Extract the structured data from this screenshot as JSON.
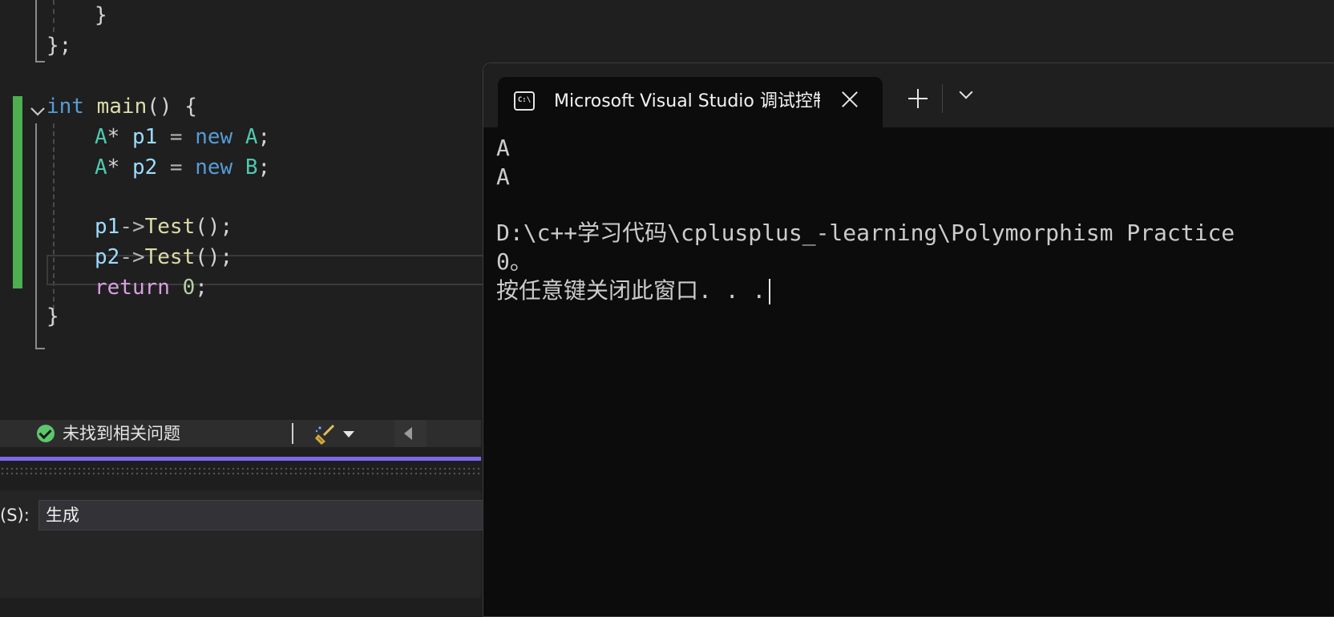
{
  "editor": {
    "lines": [
      {
        "indent": 4,
        "tokens": [
          {
            "t": "}",
            "c": "pu"
          }
        ]
      },
      {
        "indent": 0,
        "tokens": [
          {
            "t": "};",
            "c": "pu"
          }
        ]
      },
      {
        "indent": 0,
        "tokens": [
          {
            "t": "int",
            "c": "kw"
          },
          {
            "t": " ",
            "c": "pu"
          },
          {
            "t": "main",
            "c": "fn"
          },
          {
            "t": "() {",
            "c": "pu"
          }
        ]
      },
      {
        "indent": 4,
        "tokens": [
          {
            "t": "A",
            "c": "ty"
          },
          {
            "t": "* ",
            "c": "pu"
          },
          {
            "t": "p1",
            "c": "id"
          },
          {
            "t": " = ",
            "c": "op"
          },
          {
            "t": "new",
            "c": "kw"
          },
          {
            "t": " ",
            "c": "pu"
          },
          {
            "t": "A",
            "c": "ty"
          },
          {
            "t": ";",
            "c": "pu"
          }
        ]
      },
      {
        "indent": 4,
        "tokens": [
          {
            "t": "A",
            "c": "ty"
          },
          {
            "t": "* ",
            "c": "pu"
          },
          {
            "t": "p2",
            "c": "id"
          },
          {
            "t": " = ",
            "c": "op"
          },
          {
            "t": "new",
            "c": "kw"
          },
          {
            "t": " ",
            "c": "pu"
          },
          {
            "t": "B",
            "c": "ty"
          },
          {
            "t": ";",
            "c": "pu"
          }
        ]
      },
      {
        "indent": 4,
        "tokens": [
          {
            "t": "p1",
            "c": "id"
          },
          {
            "t": "->",
            "c": "op"
          },
          {
            "t": "Test",
            "c": "fn"
          },
          {
            "t": "();",
            "c": "pu"
          }
        ]
      },
      {
        "indent": 4,
        "tokens": [
          {
            "t": "p2",
            "c": "id"
          },
          {
            "t": "->",
            "c": "op"
          },
          {
            "t": "Test",
            "c": "fn"
          },
          {
            "t": "();",
            "c": "pu"
          }
        ]
      },
      {
        "indent": 4,
        "tokens": [
          {
            "t": "return",
            "c": "ctl"
          },
          {
            "t": " ",
            "c": "pu"
          },
          {
            "t": "0",
            "c": "num"
          },
          {
            "t": ";",
            "c": "pu"
          }
        ]
      },
      {
        "indent": 0,
        "tokens": [
          {
            "t": "}",
            "c": "pu"
          }
        ]
      }
    ]
  },
  "status": {
    "issues_text": "未找到相关问题",
    "ok_icon": "check-circle-icon",
    "cleanup_icon": "broom-icon"
  },
  "output": {
    "show_label": "(S):",
    "source_value": "生成"
  },
  "terminal": {
    "tab_icon_text": "C:\\",
    "tab_title": "Microsoft Visual Studio 调试控制台",
    "lines": [
      "A",
      "A",
      "",
      "D:\\c++学习代码\\cplusplus_-learning\\Polymorphism Practice",
      "0。",
      "按任意键关闭此窗口. . ."
    ]
  },
  "colors": {
    "change_bar": "#4caf50",
    "accent": "#7b68ee",
    "terminal_bg": "#0c0c0c",
    "ok_green": "#5cc86b"
  }
}
